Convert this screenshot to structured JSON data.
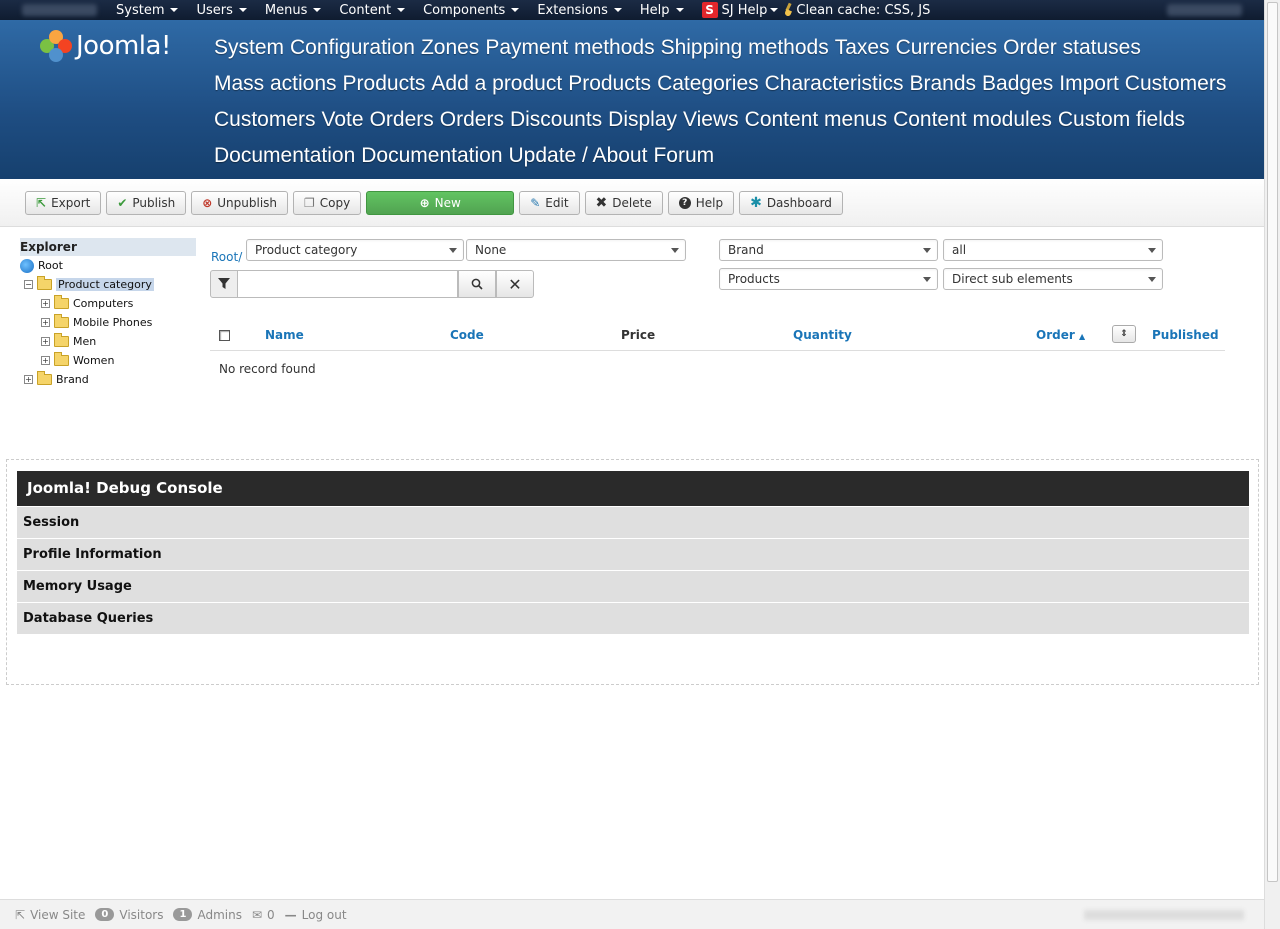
{
  "topbar": {
    "menu": [
      "System",
      "Users",
      "Menus",
      "Content",
      "Components",
      "Extensions",
      "Help"
    ],
    "sj_help": "SJ Help",
    "clean_cache": "Clean cache: CSS, JS"
  },
  "header": {
    "logo_text": "Joomla!",
    "nav": [
      "System",
      "Configuration",
      "Zones",
      "Payment methods",
      "Shipping methods",
      "Taxes",
      "Currencies",
      "Order statuses",
      "Mass actions",
      "Products",
      "Add a product",
      "Products",
      "Categories",
      "Characteristics",
      "Brands",
      "Badges",
      "Import",
      "Customers",
      "Customers",
      "Vote",
      "Orders",
      "Orders",
      "Discounts",
      "Display",
      "Views",
      "Content menus",
      "Content modules",
      "Custom fields",
      "Documentation",
      "Documentation",
      "Update / About",
      "Forum"
    ]
  },
  "toolbar": {
    "export": "Export",
    "publish": "Publish",
    "unpublish": "Unpublish",
    "copy": "Copy",
    "new": "New",
    "edit": "Edit",
    "delete": "Delete",
    "help": "Help",
    "dashboard": "Dashboard"
  },
  "explorer": {
    "title": "Explorer",
    "root": "Root",
    "product_category": "Product category",
    "children": [
      "Computers",
      "Mobile Phones",
      "Men",
      "Women"
    ],
    "brand": "Brand"
  },
  "filters": {
    "breadcrumb": "Root/",
    "category": "Product category",
    "none": "None",
    "brand": "Brand",
    "all": "all",
    "products": "Products",
    "direct": "Direct sub elements",
    "search_value": ""
  },
  "table": {
    "name": "Name",
    "code": "Code",
    "price": "Price",
    "quantity": "Quantity",
    "order": "Order",
    "published": "Published",
    "empty": "No record found"
  },
  "debug": {
    "title": "Joomla! Debug Console",
    "rows": [
      "Session",
      "Profile Information",
      "Memory Usage",
      "Database Queries"
    ]
  },
  "footer": {
    "view_site": "View Site",
    "visitors_count": "0",
    "visitors": "Visitors",
    "admins_count": "1",
    "admins": "Admins",
    "messages": "0",
    "logout": "Log out"
  }
}
